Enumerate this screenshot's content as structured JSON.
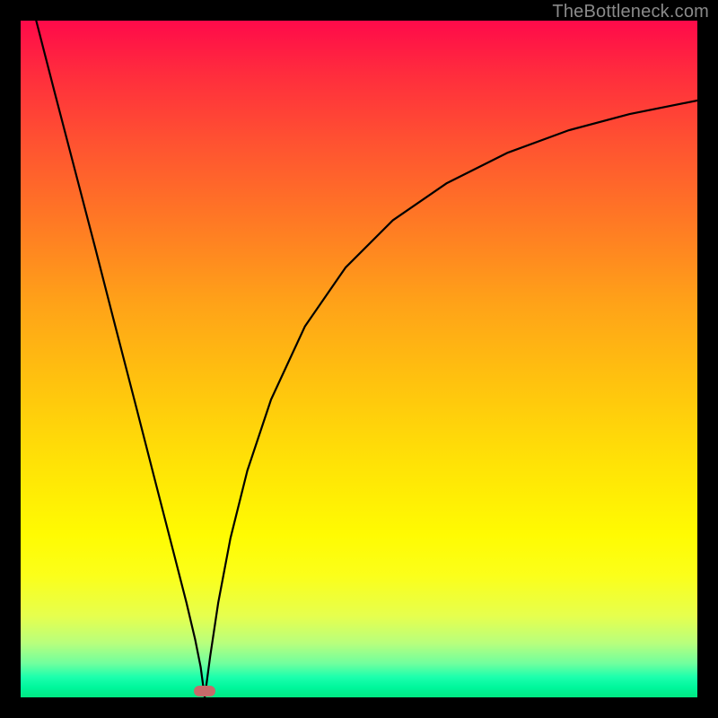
{
  "watermark": "TheBottleneck.com",
  "chart_data": {
    "type": "line",
    "title": "",
    "xlabel": "",
    "ylabel": "",
    "xlim": [
      0,
      1
    ],
    "ylim": [
      0,
      1
    ],
    "grid": false,
    "legend": false,
    "background": "vertical-gradient red→yellow→green",
    "min_point": {
      "x": 0.272,
      "y": 0.0
    },
    "series": [
      {
        "name": "left-branch",
        "x": [
          0.023,
          0.05,
          0.08,
          0.11,
          0.14,
          0.17,
          0.2,
          0.225,
          0.245,
          0.258,
          0.266,
          0.272
        ],
        "y": [
          1.0,
          0.895,
          0.78,
          0.665,
          0.548,
          0.432,
          0.315,
          0.218,
          0.14,
          0.085,
          0.045,
          0.0
        ]
      },
      {
        "name": "right-branch",
        "x": [
          0.272,
          0.28,
          0.292,
          0.31,
          0.335,
          0.37,
          0.42,
          0.48,
          0.55,
          0.63,
          0.72,
          0.81,
          0.9,
          1.0
        ],
        "y": [
          0.0,
          0.06,
          0.14,
          0.235,
          0.335,
          0.44,
          0.548,
          0.635,
          0.705,
          0.76,
          0.805,
          0.838,
          0.862,
          0.882
        ]
      }
    ],
    "marker": {
      "x": 0.272,
      "y": 0.005,
      "color": "#c76a6a"
    }
  }
}
